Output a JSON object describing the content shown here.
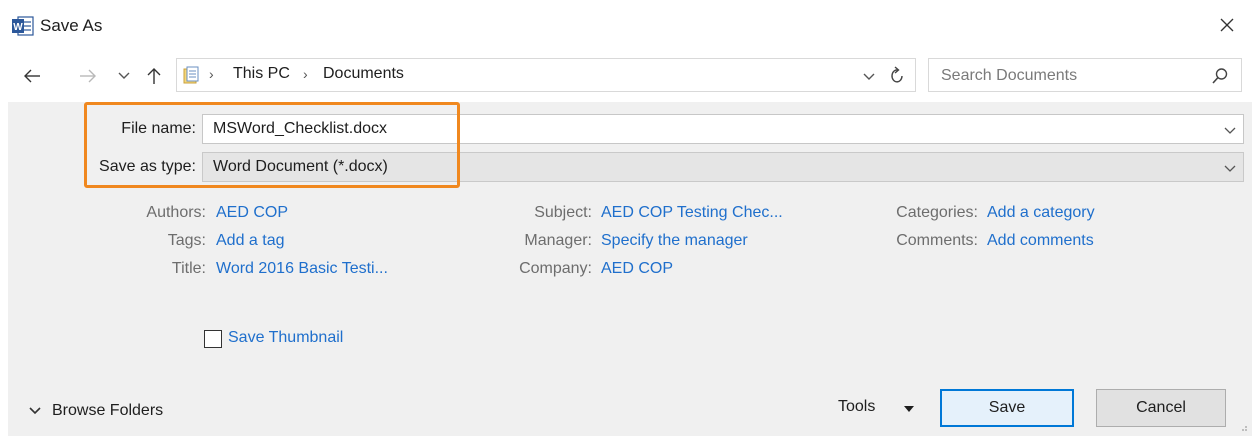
{
  "window": {
    "title": "Save As",
    "app_icon": "word-icon",
    "close_icon": "close-icon"
  },
  "nav": {
    "back_icon": "back-arrow-icon",
    "forward_icon": "forward-arrow-icon",
    "recent_icon": "chevron-down-icon",
    "up_icon": "up-arrow-icon",
    "breadcrumbs": [
      "This PC",
      "Documents"
    ],
    "search_placeholder": "Search Documents"
  },
  "form": {
    "file_name_label": "File name:",
    "file_name_value": "MSWord_Checklist.docx",
    "save_type_label": "Save as type:",
    "save_type_value": "Word Document (*.docx)",
    "highlight_color": "#f0881f"
  },
  "metadata": {
    "col1": [
      {
        "label": "Authors:",
        "value": "AED COP"
      },
      {
        "label": "Tags:",
        "value": "Add a tag"
      },
      {
        "label": "Title:",
        "value": "Word 2016 Basic Testi..."
      }
    ],
    "col2": [
      {
        "label": "Subject:",
        "value": "AED COP Testing Chec..."
      },
      {
        "label": "Manager:",
        "value": "Specify the manager"
      },
      {
        "label": "Company:",
        "value": "AED COP"
      }
    ],
    "col3": [
      {
        "label": "Categories:",
        "value": "Add a category"
      },
      {
        "label": "Comments:",
        "value": "Add comments"
      }
    ],
    "link_color": "#1f6fcc"
  },
  "options": {
    "save_thumbnail_label": "Save Thumbnail",
    "save_thumbnail_checked": false
  },
  "footer": {
    "browse_folders_label": "Browse Folders",
    "tools_label": "Tools",
    "save_label": "Save",
    "cancel_label": "Cancel",
    "accent_color": "#0078d7"
  }
}
